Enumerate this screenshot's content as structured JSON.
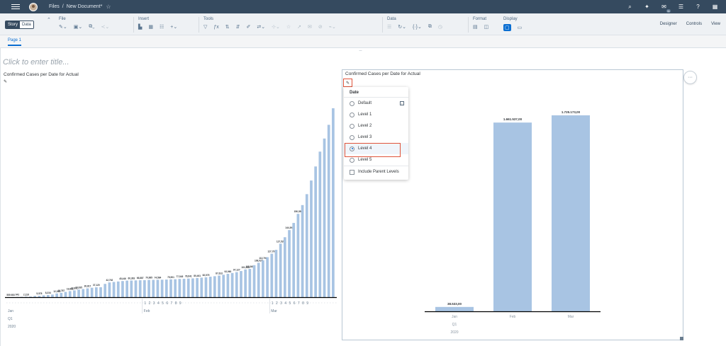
{
  "shell": {
    "breadcrumb_root": "Files",
    "breadcrumb_sep": "/",
    "document_title": "New Document*",
    "badge": "11"
  },
  "toolbar": {
    "mode_story": "Story",
    "mode_data": "Data",
    "groups": {
      "file": "File",
      "insert": "Insert",
      "tools": "Tools",
      "data": "Data",
      "format": "Format",
      "display": "Display"
    },
    "right": {
      "designer": "Designer",
      "controls": "Controls",
      "view": "View"
    }
  },
  "page_tab": "Page 1",
  "story": {
    "title_placeholder": "Click to enter title..."
  },
  "widget1": {
    "title": "Confirmed Cases per Date for Actual"
  },
  "widget2": {
    "title": "Confirmed Cases per Date for Actual"
  },
  "drill_popover": {
    "header": "Date",
    "options": [
      "Default",
      "Level 1",
      "Level 2",
      "Level 3",
      "Level 4",
      "Level 5"
    ],
    "selected": "Level 4",
    "include_parent": "Include Parent Levels"
  },
  "colors": {
    "bar": "#a8c4e3",
    "highlight": "#e0533a",
    "shell": "#354a5f",
    "accent": "#0a6ed1"
  },
  "chart_data": [
    {
      "type": "bar",
      "title": "Confirmed Cases per Date for Actual",
      "axis_levels": {
        "months": [
          "Jan",
          "Feb",
          "Mar"
        ],
        "quarter": "Q1",
        "year": "2020"
      },
      "day_ticks": [
        "1",
        "2",
        "3",
        "4",
        "5",
        "6",
        "7",
        "8",
        "9"
      ],
      "values": [
        555,
        653,
        941,
        1434,
        2118,
        2927,
        5578,
        6166,
        8234,
        9927,
        12038,
        16787,
        19881,
        23892,
        27635,
        30817,
        34391,
        37120,
        40150,
        42762,
        44802,
        45221,
        60368,
        66885,
        69030,
        71224,
        73258,
        75136,
        75639,
        76197,
        76819,
        77245,
        78166,
        78600,
        78927,
        79355,
        80000,
        80860,
        81450,
        82780,
        83400,
        84450,
        85400,
        86900,
        88600,
        90300,
        92840,
        95120,
        97886,
        101800,
        105847,
        109821,
        113590,
        118620,
        125875,
        128343,
        145193,
        156099,
        167447,
        181527,
        197142,
        214910,
        242708,
        272166,
        304524,
        336953,
        378235,
        418045,
        467653,
        529591,
        593291,
        660706,
        720117,
        782365,
        857487
      ],
      "data_labels": [
        {
          "i": 0,
          "label": "555"
        },
        {
          "i": 1,
          "label": "653"
        },
        {
          "i": 2,
          "label": "941"
        },
        {
          "i": 4,
          "label": "2,118"
        },
        {
          "i": 7,
          "label": "5,578"
        },
        {
          "i": 9,
          "label": "8,234"
        },
        {
          "i": 11,
          "label": "12,038"
        },
        {
          "i": 12,
          "label": "16,787"
        },
        {
          "i": 14,
          "label": "19,881"
        },
        {
          "i": 15,
          "label": "23,892"
        },
        {
          "i": 16,
          "label": "27,635"
        },
        {
          "i": 18,
          "label": "30,817"
        },
        {
          "i": 20,
          "label": "37,120"
        },
        {
          "i": 23,
          "label": "42,762"
        },
        {
          "i": 26,
          "label": "45,446"
        },
        {
          "i": 28,
          "label": "60,363"
        },
        {
          "i": 30,
          "label": "66,887"
        },
        {
          "i": 32,
          "label": "70,985"
        },
        {
          "i": 34,
          "label": "74,584"
        },
        {
          "i": 37,
          "label": "75,501"
        },
        {
          "i": 39,
          "label": "77,545"
        },
        {
          "i": 41,
          "label": "78,841"
        },
        {
          "i": 43,
          "label": "80,461"
        },
        {
          "i": 45,
          "label": "82,575"
        },
        {
          "i": 48,
          "label": "87,613"
        },
        {
          "i": 50,
          "label": "92,960"
        },
        {
          "i": 52,
          "label": "97,127"
        },
        {
          "i": 54,
          "label": "101,038"
        },
        {
          "i": 55,
          "label": "105,865"
        },
        {
          "i": 57,
          "label": "108,028"
        },
        {
          "i": 58,
          "label": "112,796"
        },
        {
          "i": 60,
          "label": "127,797"
        },
        {
          "i": 62,
          "label": "127,520"
        },
        {
          "i": 64,
          "label": "144,393"
        },
        {
          "i": 66,
          "label": "156,356"
        }
      ]
    },
    {
      "type": "bar",
      "title": "Confirmed Cases per Date for Actual",
      "categories": [
        "Jan",
        "Feb",
        "Mar"
      ],
      "values": [
        38533,
        1661537,
        1725173
      ],
      "value_labels": [
        "38.533,00",
        "1.661.537,00",
        "1.725.173,00"
      ],
      "quarter": "Q1",
      "year": "2020"
    }
  ]
}
